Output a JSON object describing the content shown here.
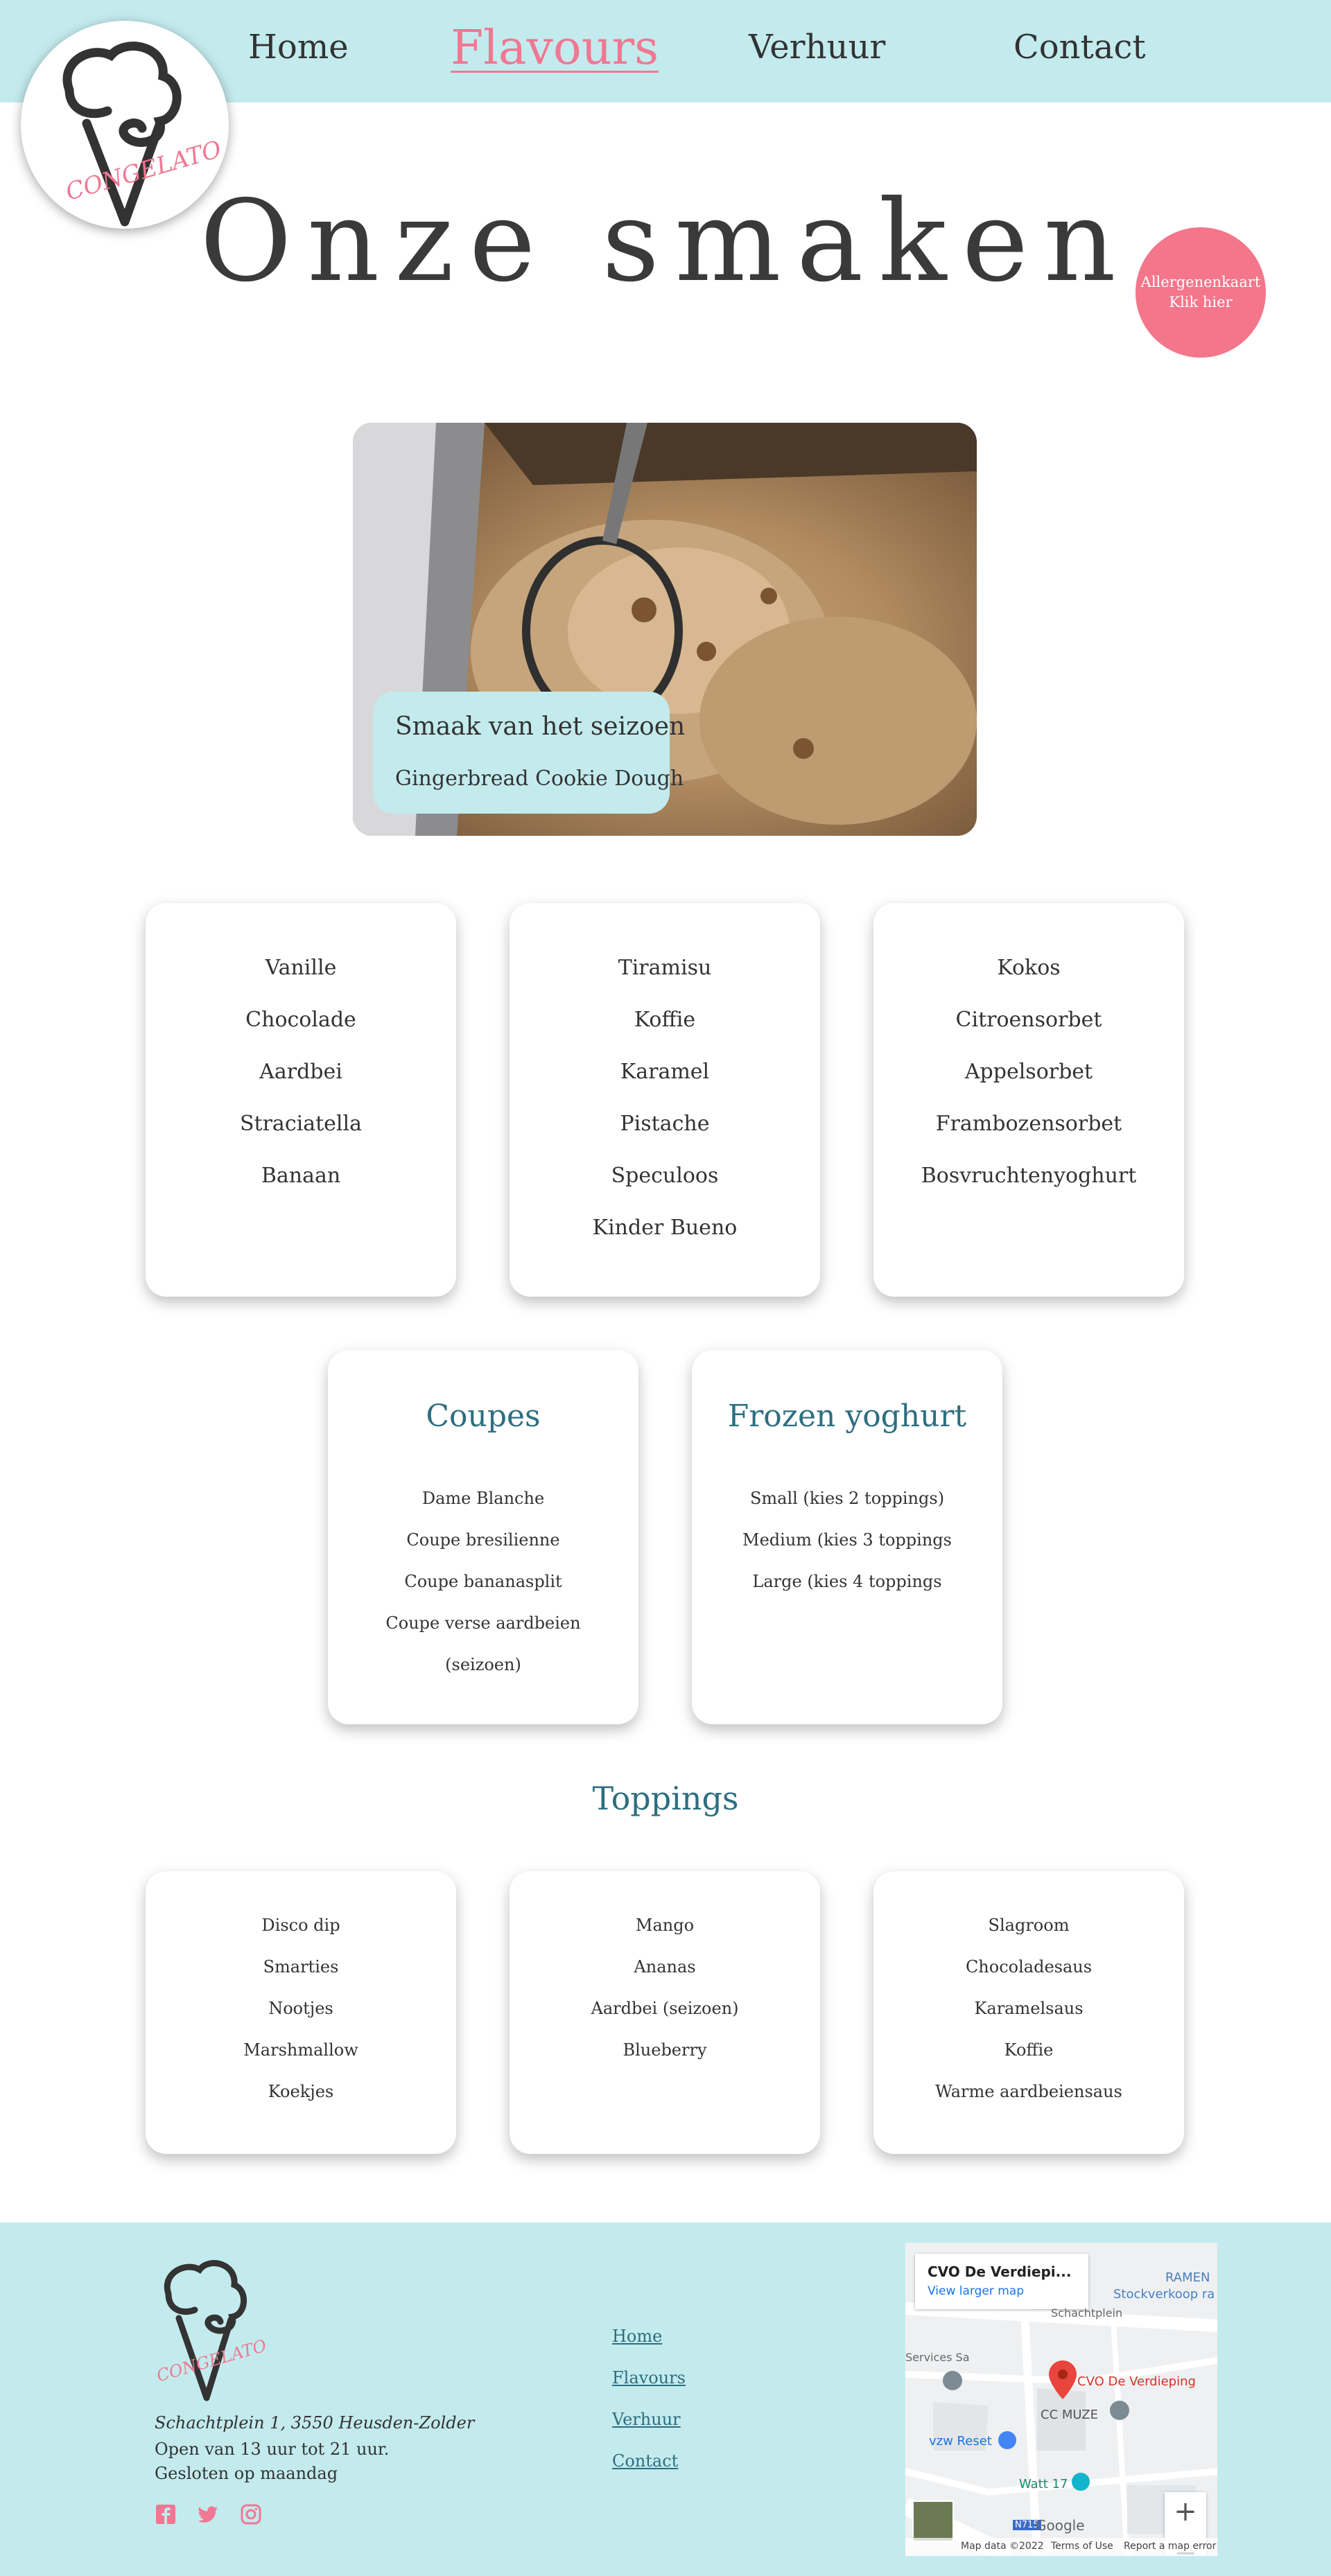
{
  "nav": {
    "home": "Home",
    "flavours": "Flavours",
    "verhuur": "Verhuur",
    "contact": "Contact"
  },
  "logo_text": "CONGELATO",
  "hero": {
    "title": "Onze smaken"
  },
  "allergen": {
    "line1": "Allergenenkaart",
    "line2": "Klik hier"
  },
  "season": {
    "title": "Smaak van het seizoen",
    "flavour": "Gingerbread Cookie Dough"
  },
  "flavour_columns": [
    [
      "Vanille",
      "Chocolade",
      "Aardbei",
      "Straciatella",
      "Banaan"
    ],
    [
      "Tiramisu",
      "Koffie",
      "Karamel",
      "Pistache",
      "Speculoos",
      "Kinder Bueno"
    ],
    [
      "Kokos",
      "Citroensorbet",
      "Appelsorbet",
      "Frambozensorbet",
      "Bosvruchtenyoghurt"
    ]
  ],
  "coupes": {
    "title": "Coupes",
    "items": [
      "Dame Blanche",
      "Coupe bresilienne",
      "Coupe bananasplit",
      "Coupe verse aardbeien",
      "(seizoen)"
    ]
  },
  "frozen": {
    "title": "Frozen yoghurt",
    "items": [
      "Small (kies 2 toppings)",
      "Medium (kies 3 toppings",
      "Large (kies 4 toppings"
    ]
  },
  "toppings": {
    "title": "Toppings",
    "columns": [
      [
        "Disco dip",
        "Smarties",
        "Nootjes",
        "Marshmallow",
        "Koekjes"
      ],
      [
        "Mango",
        "Ananas",
        "Aardbei (seizoen)",
        "Blueberry"
      ],
      [
        "Slagroom",
        "Chocoladesaus",
        "Karamelsaus",
        "Koffie",
        "Warme aardbeiensaus"
      ]
    ]
  },
  "footer": {
    "address": "Schachtplein 1, 3550 Heusden-Zolder",
    "hours": "Open van 13 uur tot 21 uur. Gesloten op maandag",
    "links": [
      "Home",
      "Flavours",
      "Verhuur",
      "Contact"
    ],
    "social_icons": [
      "facebook-icon",
      "twitter-icon",
      "instagram-icon"
    ]
  },
  "map": {
    "place_name": "CVO De Verdiepi...",
    "larger_link": "View larger map",
    "pin_label": "CVO De Verdieping",
    "labels": [
      "RAMEN",
      "Stockverkoop ra",
      "Schachtplein",
      "Services Sa",
      "CC MUZE",
      "vzw Reset",
      "Watt 17",
      "N715",
      "Google",
      "Map data ©2022",
      "Terms of Use",
      "Report a map error"
    ]
  },
  "colors": {
    "header_bg": "#c3ebee",
    "accent_pink": "#f07892",
    "allergen_pink": "#f4768b",
    "heading_teal": "#2d6e80"
  }
}
